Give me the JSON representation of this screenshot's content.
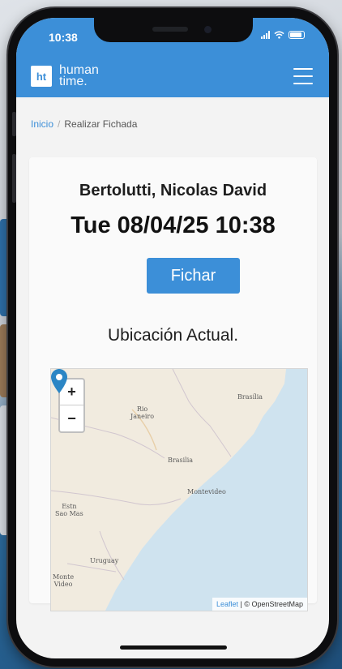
{
  "status_bar": {
    "time": "10:38"
  },
  "header": {
    "logo_mark": "ht",
    "logo_line1": "human",
    "logo_line2": "time.",
    "menu_icon": "hamburger-menu-icon"
  },
  "breadcrumb": {
    "home": "Inicio",
    "separator": "/",
    "current": "Realizar Fichada"
  },
  "card": {
    "employee_name": "Bertolutti, Nicolas David",
    "datetime": "Tue 08/04/25 10:38",
    "action_label": "Fichar",
    "location_title": "Ubicación Actual."
  },
  "map": {
    "zoom_in": "+",
    "zoom_out": "−",
    "labels": {
      "brasilia": "Brasília",
      "rio": "Rio\nJaneiro",
      "brasilia2": "Brasilia",
      "montevideo": "Montevideo",
      "sao_paulo": "Estn\nSao Mas",
      "uruguay": "Uruguay",
      "monte_video": "Monte\nVideo"
    },
    "attribution_leaflet": "Leaflet",
    "attribution_osm": "| © OpenStreetMap",
    "marker_icon": "map-pin-icon"
  },
  "colors": {
    "brand": "#3c8fd8",
    "marker": "#2b86c5"
  }
}
